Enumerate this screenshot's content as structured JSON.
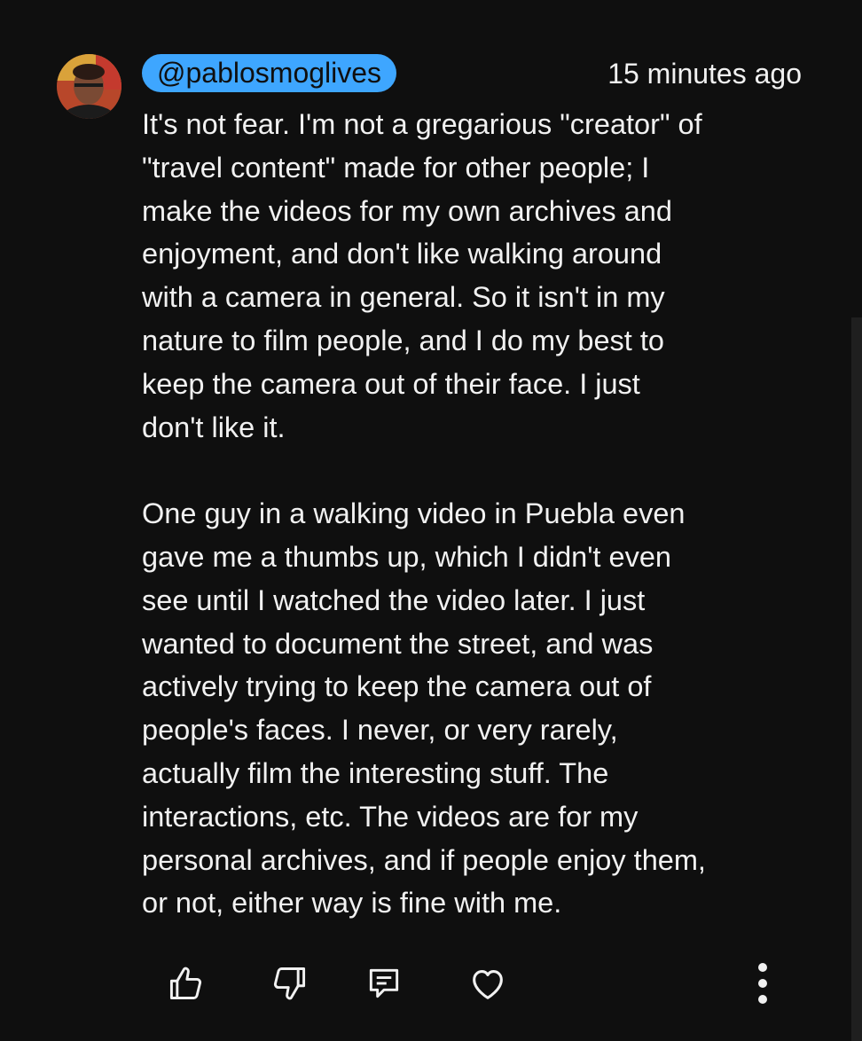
{
  "comment": {
    "author": "@pablosmoglives",
    "timestamp": "15 minutes ago",
    "paragraphs": [
      "It's not fear. I'm not a gregarious \"creator\" of\n\"travel content\" made for other people; I\nmake the videos for my own archives and\nenjoyment, and don't like walking around\nwith a camera in general. So it isn't in my\nnature to film people, and I do my best to\nkeep the camera out of their face. I just\ndon't like it.",
      "One guy in a walking video in Puebla even\ngave me a thumbs up, which I didn't even\nsee until I watched the video later. I just\nwanted to document the street, and was\nactively trying to keep the camera out of\npeople's faces. I never, or very rarely,\nactually film the interesting stuff. The\ninteractions, etc. The videos are for my\npersonal archives, and if people enjoy them,\nor not, either way is fine with me."
    ]
  },
  "actions": [
    {
      "icon": "thumbs-up-icon"
    },
    {
      "icon": "thumbs-down-icon"
    },
    {
      "icon": "reply-icon"
    },
    {
      "icon": "heart-icon"
    },
    {
      "icon": "more-vertical-icon"
    }
  ],
  "colors": {
    "background": "#0f0f0f",
    "text": "#f1f1f1",
    "author_pill": "#3ea6ff"
  }
}
